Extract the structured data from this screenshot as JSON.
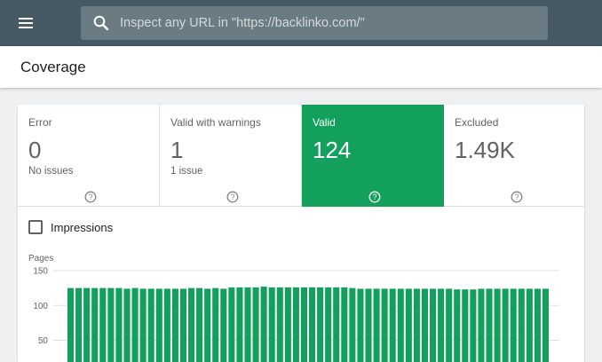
{
  "header": {
    "menu_icon": "menu-icon",
    "search": {
      "icon": "search-icon",
      "placeholder": "Inspect any URL in \"https://backlinko.com/\""
    }
  },
  "page": {
    "title": "Coverage"
  },
  "tiles": [
    {
      "label": "Error",
      "value": "0",
      "sub": "No issues",
      "active": false
    },
    {
      "label": "Valid with warnings",
      "value": "1",
      "sub": "1 issue",
      "active": false
    },
    {
      "label": "Valid",
      "value": "124",
      "sub": "",
      "active": true
    },
    {
      "label": "Excluded",
      "value": "1.49K",
      "sub": "",
      "active": false
    }
  ],
  "impressions": {
    "label": "Impressions",
    "checked": false
  },
  "colors": {
    "topbar": "#455a64",
    "valid": "#12a05c",
    "bar": "#12a05c"
  },
  "chart_data": {
    "type": "bar",
    "ylabel": "Pages",
    "yticks": [
      150,
      100,
      50
    ],
    "ylim": [
      0,
      150
    ],
    "grid": true,
    "series": [
      {
        "values": [
          125,
          125,
          125,
          125,
          125,
          125,
          125,
          124,
          125,
          124,
          124,
          124,
          124,
          124,
          124,
          125,
          125,
          124,
          125,
          124,
          126,
          126,
          126,
          126,
          127,
          126,
          126,
          126,
          126,
          126,
          126,
          126,
          126,
          126,
          126,
          125,
          124,
          124,
          124,
          124,
          124,
          124,
          124,
          124,
          124,
          124,
          124,
          124,
          123,
          123,
          123,
          124,
          124,
          124,
          124,
          124,
          124,
          124,
          124,
          124
        ]
      }
    ]
  }
}
